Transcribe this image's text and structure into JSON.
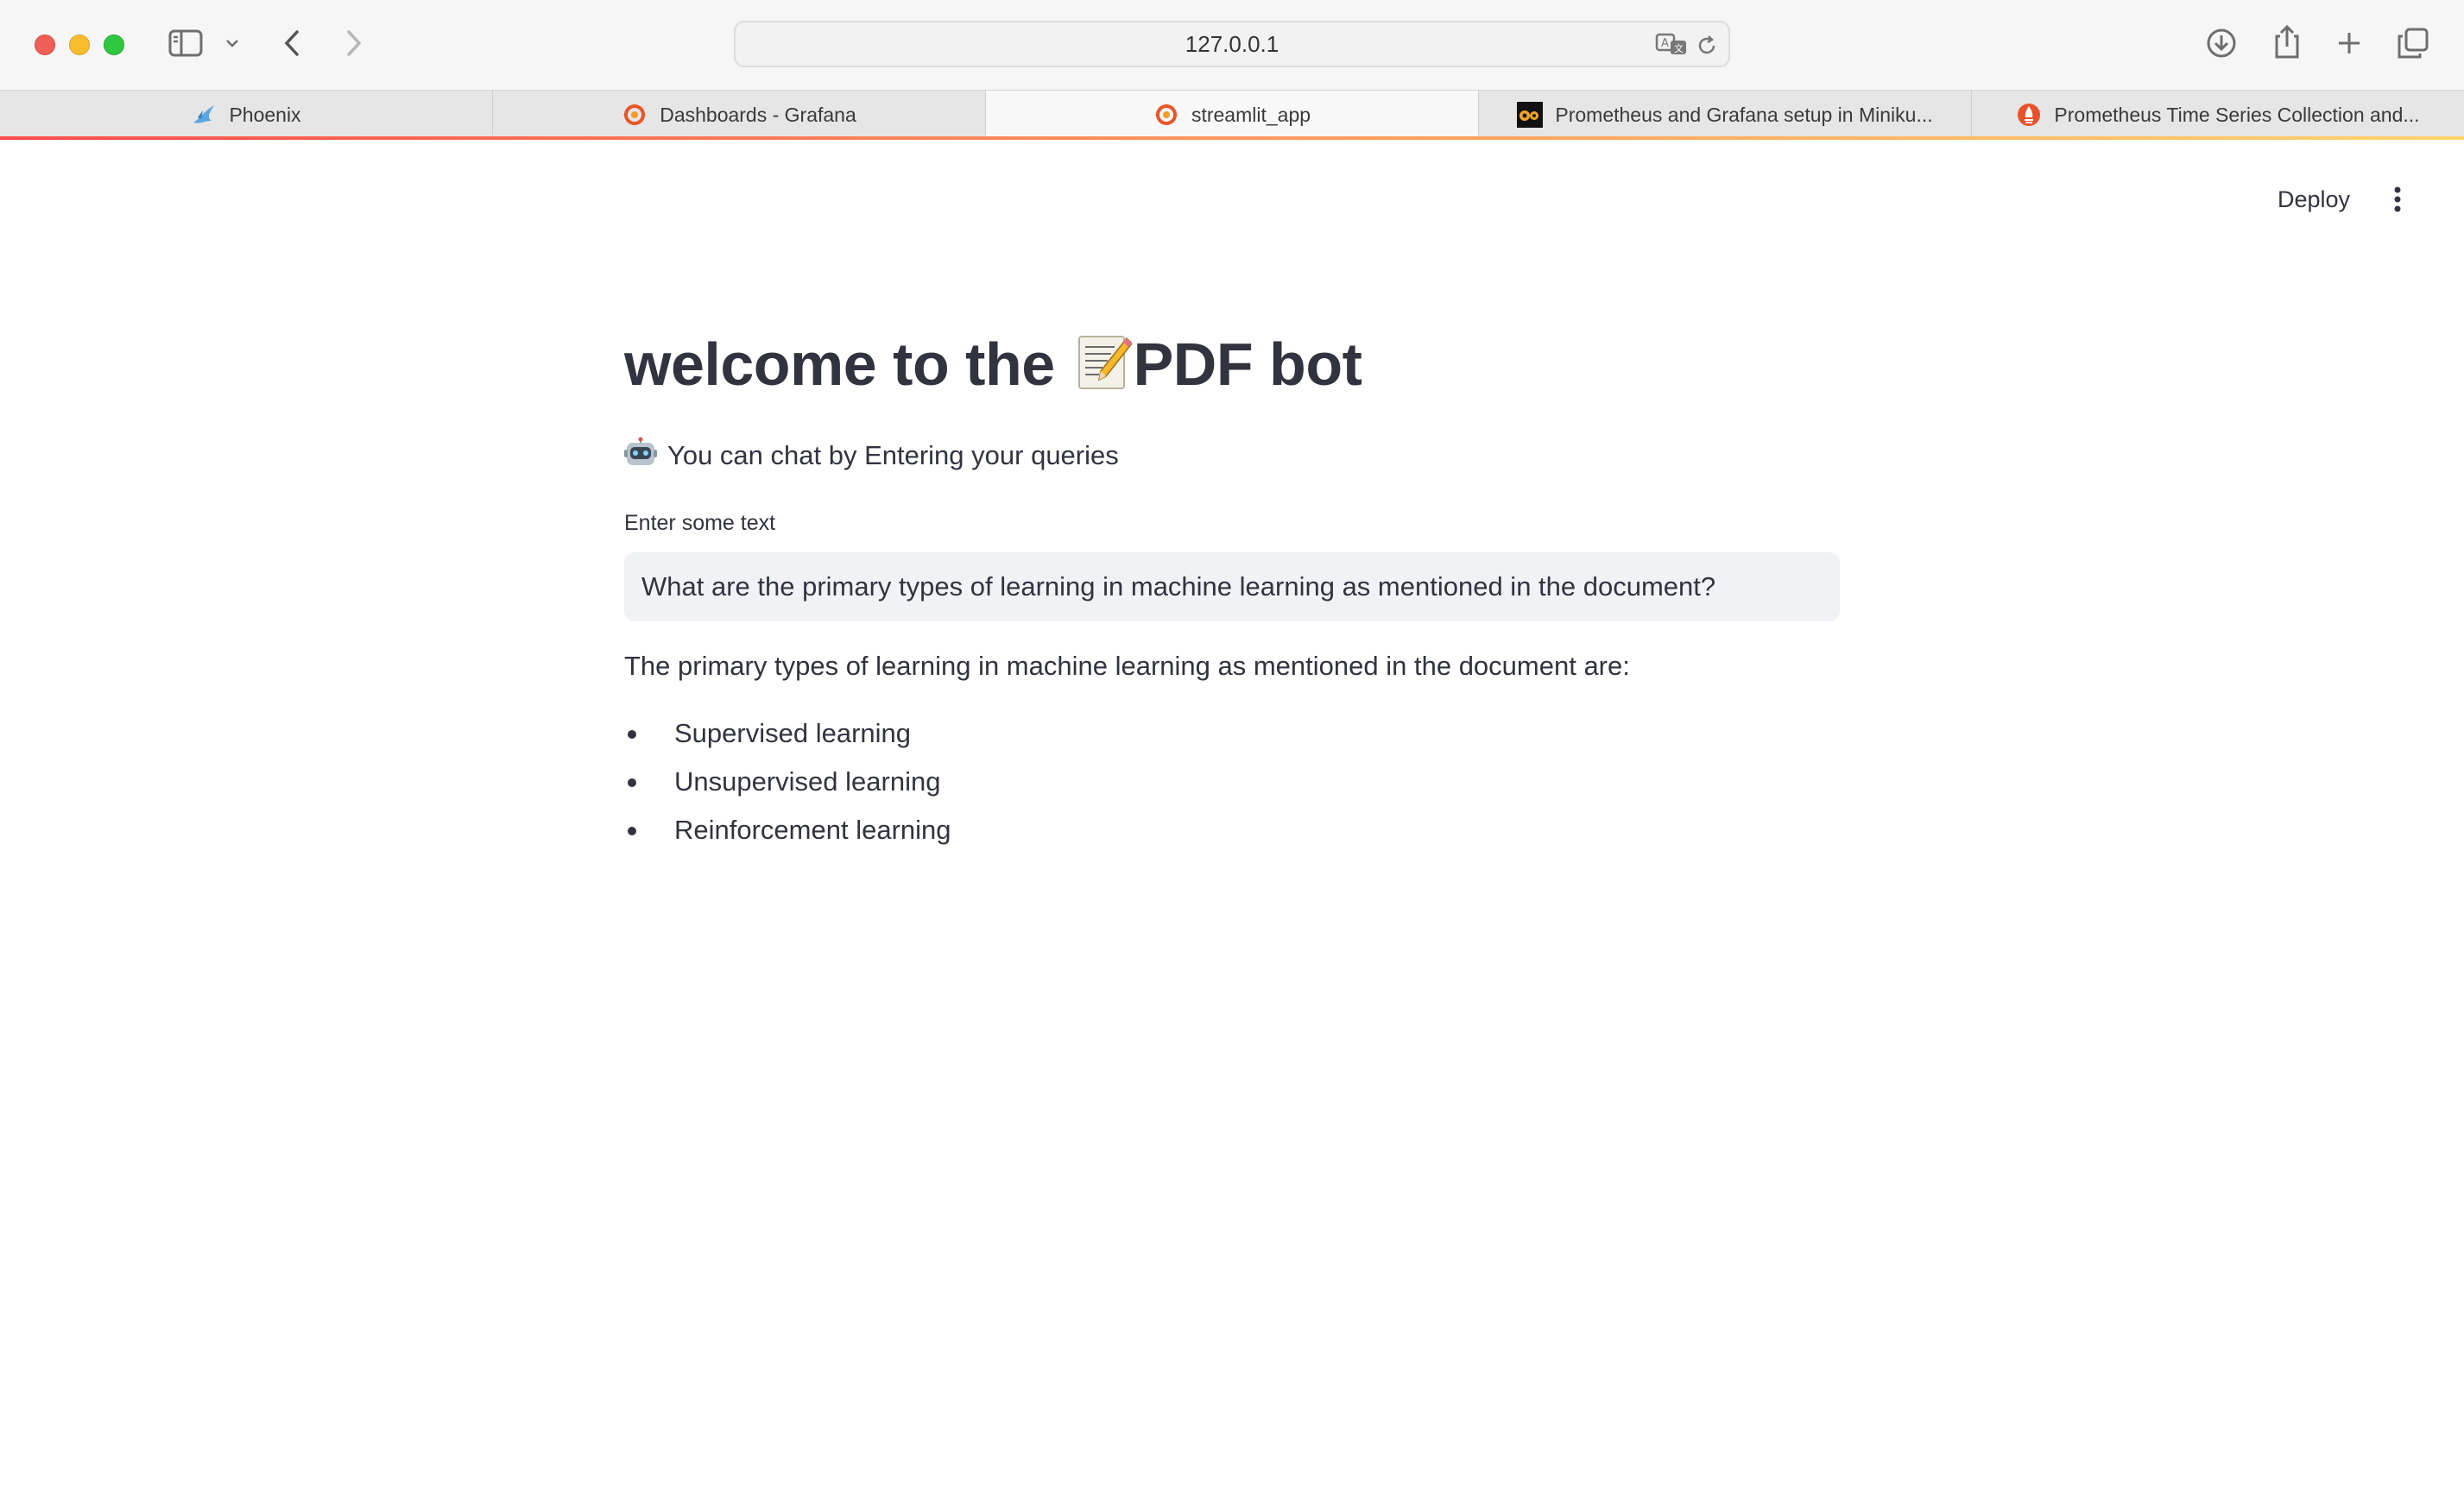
{
  "browser": {
    "url": "127.0.0.1",
    "tabs": [
      {
        "label": "Phoenix",
        "icon": "phoenix-bird-icon",
        "active": false
      },
      {
        "label": "Dashboards - Grafana",
        "icon": "grafana-icon",
        "active": false
      },
      {
        "label": "streamlit_app",
        "icon": "grafana-icon",
        "active": true
      },
      {
        "label": "Prometheus and Grafana setup in Miniku...",
        "icon": "medium-icon",
        "active": false
      },
      {
        "label": "Prometheus Time Series Collection and...",
        "icon": "prometheus-icon",
        "active": false
      }
    ],
    "colors": {
      "close": "#ee5f57",
      "minimize": "#f7bd2e",
      "maximize": "#2fc840",
      "accent": "#ff4b4b"
    }
  },
  "app": {
    "deploy_label": "Deploy",
    "title_prefix": "welcome to the ",
    "title_emoji": "memo-icon",
    "title_suffix": "PDF bot",
    "subtitle_emoji": "robot-icon",
    "subtitle": "You can chat by Entering your queries",
    "input_label": "Enter some text",
    "input_value": "What are the primary types of learning in machine learning as mentioned in the document?",
    "answer_intro": "The primary types of learning in machine learning as mentioned in the document are:",
    "answer_items": [
      "Supervised learning",
      "Unsupervised learning",
      "Reinforcement learning"
    ],
    "text_color": "#31333f",
    "input_bg": "#f0f2f6"
  }
}
